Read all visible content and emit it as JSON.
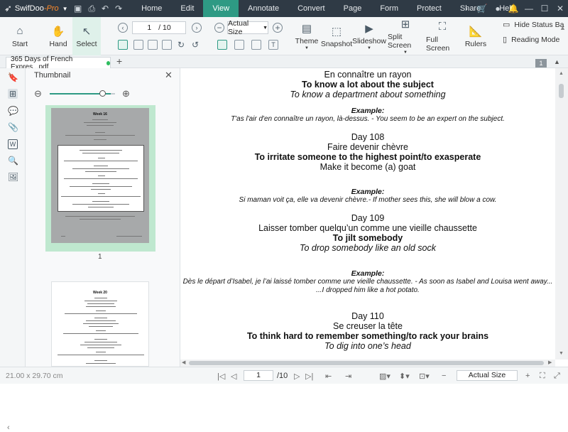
{
  "app": {
    "name": "SwifDoo",
    "edition": "-Pro"
  },
  "menu": [
    "Home",
    "Edit",
    "View",
    "Annotate",
    "Convert",
    "Page",
    "Form",
    "Protect",
    "Share",
    "Help"
  ],
  "menu_active": "View",
  "toolbar": {
    "start": "Start",
    "hand": "Hand",
    "select": "Select",
    "page_current": "1",
    "page_total": "/ 10",
    "zoom": "Actual Size",
    "theme": "Theme",
    "snapshot": "Snapshot",
    "slideshow": "Slideshow",
    "split_screen": "Split Screen",
    "full_screen": "Full Screen",
    "rulers": "Rulers",
    "hide_status_bar": "Hide Status Ba",
    "reading_mode": "Reading Mode"
  },
  "tab": {
    "filename": "365 Days of French Expres...pdf",
    "page_badge": "1"
  },
  "thumbnail_panel": {
    "title": "Thumbnail",
    "page1_label": "1",
    "page1_heading": "Week 16",
    "page2_heading": "Week 20"
  },
  "document": {
    "lines": [
      {
        "style": "norm",
        "text": "En connaître un rayon"
      },
      {
        "style": "bold",
        "text": "To know a lot about the subject"
      },
      {
        "style": "ital",
        "text": "To know a department about something"
      },
      {
        "style": "exh",
        "text": "Example:"
      },
      {
        "style": "exs",
        "text": "T'as l'air d'en connaître un rayon, là-dessus. - You seem to be an expert on the subject."
      },
      {
        "style": "norm",
        "text": "Day 108"
      },
      {
        "style": "norm",
        "text": "Faire devenir chèvre"
      },
      {
        "style": "bold",
        "text": "To irritate someone to the highest point/to exasperate"
      },
      {
        "style": "norm",
        "text": "Make it become (a) goat"
      },
      {
        "style": "exh",
        "text": "Example:"
      },
      {
        "style": "exs",
        "text": "Si maman voit ça, elle va devenir chèvre.- If mother sees this, she will blow a cow."
      },
      {
        "style": "norm",
        "text": "Day 109"
      },
      {
        "style": "norm",
        "text": "Laisser tomber quelqu’un comme une vieille chaussette"
      },
      {
        "style": "bold",
        "text": "To jilt somebody"
      },
      {
        "style": "ital",
        "text": "To drop somebody like an old sock"
      },
      {
        "style": "exh",
        "text": "Example:"
      },
      {
        "style": "exs",
        "text": "Dès le départ d’Isabel, je l’ai laissé tomber comme une vieille chaussette. - As soon as Isabel and Louisa went away..."
      },
      {
        "style": "exs",
        "text": "...I dropped him like a hot potato."
      },
      {
        "style": "norm",
        "text": "Day 110"
      },
      {
        "style": "norm",
        "text": "Se creuser la tête"
      },
      {
        "style": "bold",
        "text": "To think hard to remember something/to rack your brains"
      },
      {
        "style": "ital",
        "text": "To dig into one’s head"
      }
    ]
  },
  "status": {
    "page_size": "21.00 x 29.70 cm",
    "page_current": "1",
    "page_total": "/10",
    "zoom": "Actual Size"
  }
}
